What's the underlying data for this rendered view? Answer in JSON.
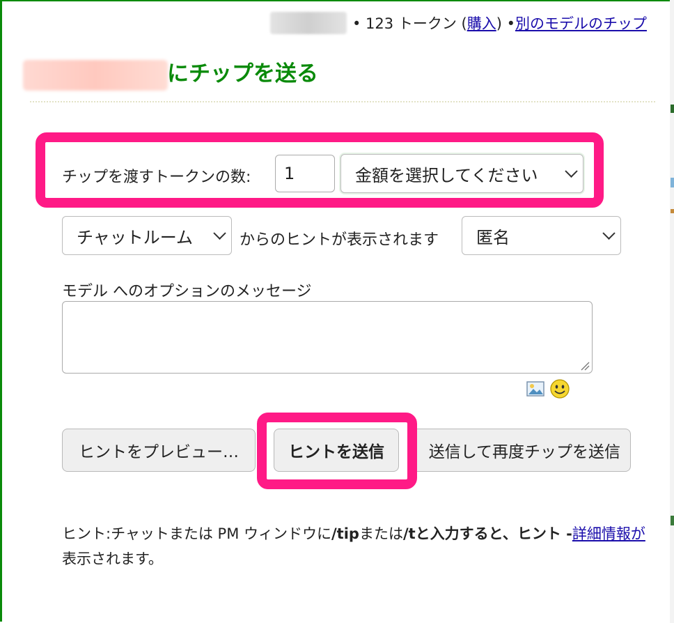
{
  "header": {
    "token_text": "• 123 トークン (",
    "buy_link": "購入",
    "close_paren": ") •",
    "other_model_link": "別のモデルのチップ"
  },
  "title": "にチップを送る",
  "tip_form": {
    "tokens_label": "チップを渡すトークンの数:",
    "tokens_value": "1",
    "amount_select": "金額を選択してください",
    "room_select": "チャットルーム",
    "hint_visible_label": "からのヒントが表示されます",
    "anonymity_select": "匿名",
    "message_label": "モデル へのオプションのメッセージ",
    "message_value": ""
  },
  "buttons": {
    "preview": "ヒントをプレビュー…",
    "send": "ヒントを送信",
    "send_again": "送信して再度チップを送信"
  },
  "hint": {
    "prefix": "ヒント:チャットまたは PM ウィンドウに",
    "cmd_tip": "/tip",
    "or": "または",
    "cmd_t": "/t",
    "bold_tail": "と入力すると、ヒント -",
    "details_link": "詳細情報が",
    "suffix": "表示されます。"
  },
  "colors": {
    "accent_green": "#0a8a0a",
    "highlight_pink": "#ff1a86",
    "link_blue": "#1a0dab"
  }
}
